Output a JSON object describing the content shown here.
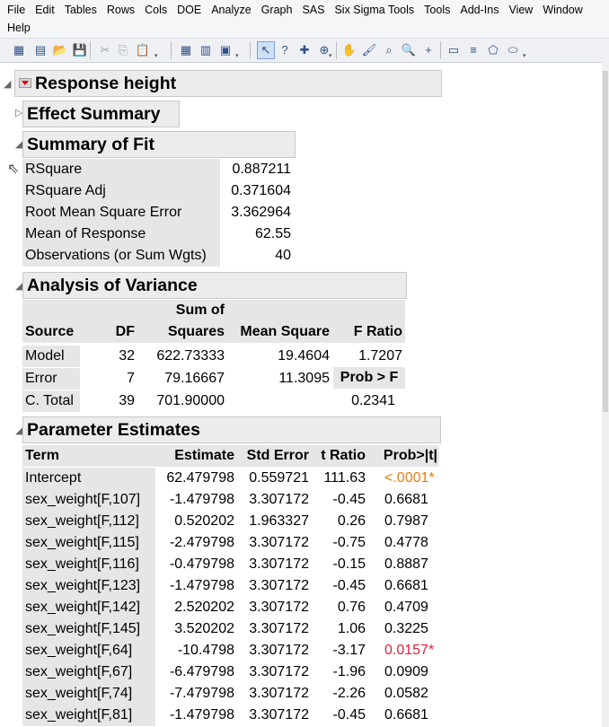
{
  "menu": {
    "row1": [
      "File",
      "Edit",
      "Tables",
      "Rows",
      "Cols",
      "DOE",
      "Analyze",
      "Graph",
      "SAS",
      "Six Sigma Tools",
      "Tools",
      "Add-Ins",
      "View",
      "Window"
    ],
    "row2": [
      "Help"
    ]
  },
  "toolbar_icons": [
    {
      "name": "new-data-table-icon",
      "glyph": "▦"
    },
    {
      "name": "new-script-icon",
      "glyph": "▤"
    },
    {
      "name": "open-icon",
      "glyph": "📂"
    },
    {
      "name": "save-icon",
      "glyph": "💾"
    },
    {
      "name": "cut-icon",
      "glyph": "✂"
    },
    {
      "name": "copy-icon",
      "glyph": "⎘"
    },
    {
      "name": "paste-icon",
      "glyph": "📋"
    },
    {
      "name": "data-grid-icon",
      "glyph": "▦"
    },
    {
      "name": "journal-icon",
      "glyph": "▥"
    },
    {
      "name": "layout-icon",
      "glyph": "▣"
    },
    {
      "name": "arrow-tool-icon",
      "glyph": "↖"
    },
    {
      "name": "help-tool-icon",
      "glyph": "?"
    },
    {
      "name": "crosshair-tool-icon",
      "glyph": "✚"
    },
    {
      "name": "target-tool-icon",
      "glyph": "⊕"
    },
    {
      "name": "grabber-tool-icon",
      "glyph": "✋"
    },
    {
      "name": "brush-tool-icon",
      "glyph": "🖌"
    },
    {
      "name": "lasso-tool-icon",
      "glyph": "⌕"
    },
    {
      "name": "magnifier-tool-icon",
      "glyph": "🔍"
    },
    {
      "name": "plus-tool-icon",
      "glyph": "+"
    },
    {
      "name": "annotate-tool-icon",
      "glyph": "▭"
    },
    {
      "name": "line-tool-icon",
      "glyph": "≡"
    },
    {
      "name": "polygon-tool-icon",
      "glyph": "⬠"
    },
    {
      "name": "oval-tool-icon",
      "glyph": "⬭"
    }
  ],
  "report": {
    "title": "Response height",
    "effect_summary": "Effect Summary",
    "summary_of_fit": {
      "title": "Summary of Fit",
      "rows": [
        {
          "label": "RSquare",
          "value": "0.887211"
        },
        {
          "label": "RSquare Adj",
          "value": "0.371604"
        },
        {
          "label": "Root Mean Square Error",
          "value": "3.362964"
        },
        {
          "label": "Mean of Response",
          "value": "62.55"
        },
        {
          "label": "Observations (or Sum Wgts)",
          "value": "40"
        }
      ]
    },
    "anova": {
      "title": "Analysis of Variance",
      "headers": {
        "source": "Source",
        "df": "DF",
        "ss_top": "Sum of",
        "ss_bottom": "Squares",
        "ms": "Mean Square",
        "f": "F Ratio",
        "prob": "Prob > F"
      },
      "rows": [
        {
          "source": "Model",
          "df": "32",
          "ss": "622.73333",
          "ms": "19.4604",
          "f": "1.7207"
        },
        {
          "source": "Error",
          "df": "7",
          "ss": "79.16667",
          "ms": "11.3095",
          "f": ""
        },
        {
          "source": "C. Total",
          "df": "39",
          "ss": "701.90000",
          "ms": "",
          "f": "0.2341"
        }
      ]
    },
    "parameters": {
      "title": "Parameter Estimates",
      "headers": {
        "term": "Term",
        "estimate": "Estimate",
        "stderr": "Std Error",
        "t": "t Ratio",
        "p": "Prob>|t|"
      },
      "rows": [
        {
          "term": "Intercept",
          "estimate": "62.479798",
          "stderr": "0.559721",
          "t": "111.63",
          "p": "<.0001*",
          "p_color": "#e87c0e"
        },
        {
          "term": "sex_weight[F,107]",
          "estimate": "-1.479798",
          "stderr": "3.307172",
          "t": "-0.45",
          "p": "0.6681",
          "p_color": ""
        },
        {
          "term": "sex_weight[F,112]",
          "estimate": "0.520202",
          "stderr": "1.963327",
          "t": "0.26",
          "p": "0.7987",
          "p_color": ""
        },
        {
          "term": "sex_weight[F,115]",
          "estimate": "-2.479798",
          "stderr": "3.307172",
          "t": "-0.75",
          "p": "0.4778",
          "p_color": ""
        },
        {
          "term": "sex_weight[F,116]",
          "estimate": "-0.479798",
          "stderr": "3.307172",
          "t": "-0.15",
          "p": "0.8887",
          "p_color": ""
        },
        {
          "term": "sex_weight[F,123]",
          "estimate": "-1.479798",
          "stderr": "3.307172",
          "t": "-0.45",
          "p": "0.6681",
          "p_color": ""
        },
        {
          "term": "sex_weight[F,142]",
          "estimate": "2.520202",
          "stderr": "3.307172",
          "t": "0.76",
          "p": "0.4709",
          "p_color": ""
        },
        {
          "term": "sex_weight[F,145]",
          "estimate": "3.520202",
          "stderr": "3.307172",
          "t": "1.06",
          "p": "0.3225",
          "p_color": ""
        },
        {
          "term": "sex_weight[F,64]",
          "estimate": "-10.4798",
          "stderr": "3.307172",
          "t": "-3.17",
          "p": "0.0157*",
          "p_color": "#e0203a"
        },
        {
          "term": "sex_weight[F,67]",
          "estimate": "-6.479798",
          "stderr": "3.307172",
          "t": "-1.96",
          "p": "0.0909",
          "p_color": ""
        },
        {
          "term": "sex_weight[F,74]",
          "estimate": "-7.479798",
          "stderr": "3.307172",
          "t": "-2.26",
          "p": "0.0582",
          "p_color": ""
        },
        {
          "term": "sex_weight[F,81]",
          "estimate": "-1.479798",
          "stderr": "3.307172",
          "t": "-0.45",
          "p": "0.6681",
          "p_color": ""
        }
      ]
    }
  }
}
